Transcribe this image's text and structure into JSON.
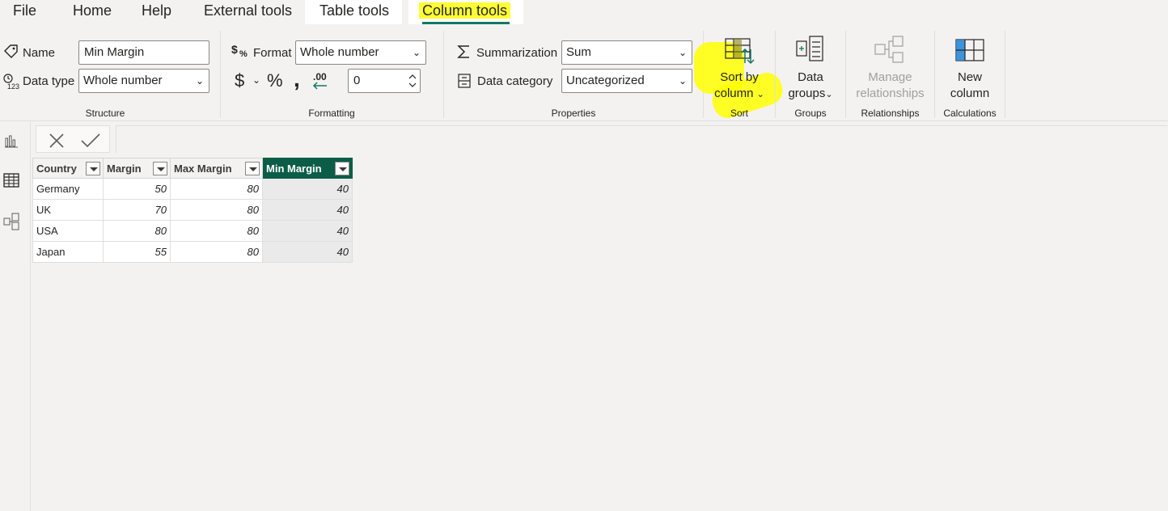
{
  "tabs": [
    "File",
    "Home",
    "Help",
    "External tools",
    "Table tools",
    "Column tools"
  ],
  "structure": {
    "group_label": "Structure",
    "name_label": "Name",
    "name_value": "Min Margin",
    "datatype_label": "Data type",
    "datatype_value": "Whole number"
  },
  "formatting": {
    "group_label": "Formatting",
    "format_label": "Format",
    "format_value": "Whole number",
    "currency_symbol": "$",
    "percent_symbol": "%",
    "comma_symbol": ",",
    "decimal_symbol": ".00",
    "decimals_value": "0"
  },
  "properties": {
    "group_label": "Properties",
    "summarization_label": "Summarization",
    "summarization_value": "Sum",
    "category_label": "Data category",
    "category_value": "Uncategorized"
  },
  "sort": {
    "group_label": "Sort",
    "btn_line1": "Sort by",
    "btn_line2": "column"
  },
  "groups": {
    "group_label": "Groups",
    "btn_line1": "Data",
    "btn_line2": "groups"
  },
  "relationships": {
    "group_label": "Relationships",
    "btn_line1": "Manage",
    "btn_line2": "relationships"
  },
  "calculations": {
    "group_label": "Calculations",
    "btn_line1": "New",
    "btn_line2": "column"
  },
  "table": {
    "columns": [
      "Country",
      "Margin",
      "Max Margin",
      "Min Margin"
    ],
    "selected_column": "Min Margin",
    "rows": [
      [
        "Germany",
        "50",
        "80",
        "40"
      ],
      [
        "UK",
        "70",
        "80",
        "40"
      ],
      [
        "USA",
        "80",
        "80",
        "40"
      ],
      [
        "Japan",
        "55",
        "80",
        "40"
      ]
    ]
  },
  "icons": {
    "name": "tag-icon",
    "datatype": "datatype-123-icon",
    "format": "dollar-percent-icon",
    "summarization": "sigma-icon",
    "category": "data-category-icon",
    "sort": "sort-by-column-icon",
    "groups": "data-groups-icon",
    "relationships": "manage-relationships-icon",
    "calculations": "new-column-icon",
    "report": "report-view-icon",
    "data": "data-view-icon",
    "model": "model-view-icon",
    "cancel": "close-icon",
    "commit": "checkmark-icon"
  },
  "colors": {
    "accent": "#117865",
    "selected_header": "#0b5d47",
    "highlight": "#ffff00"
  }
}
